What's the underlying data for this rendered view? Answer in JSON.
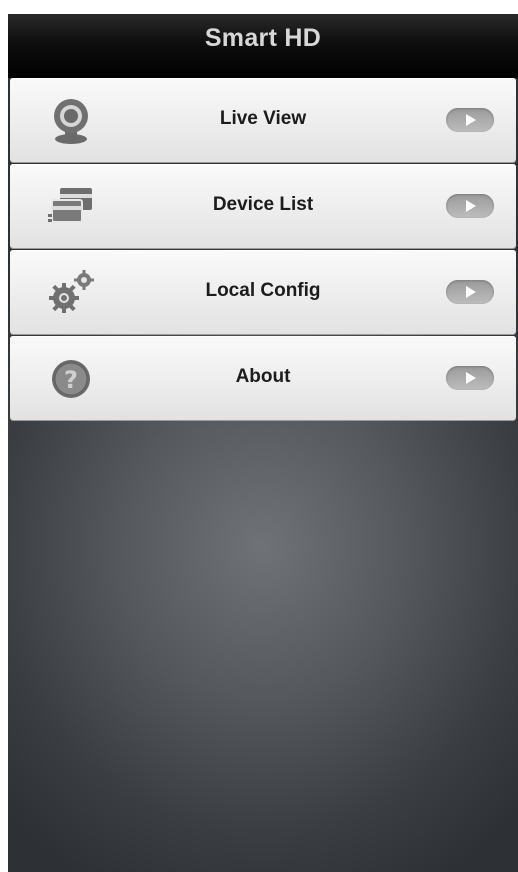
{
  "app": {
    "title": "Smart HD"
  },
  "menu": {
    "items": [
      {
        "label": "Live View",
        "icon": "webcam-icon"
      },
      {
        "label": "Device List",
        "icon": "device-list-icon"
      },
      {
        "label": "Local Config",
        "icon": "gears-icon"
      },
      {
        "label": "About",
        "icon": "help-icon"
      }
    ]
  },
  "colors": {
    "titlebar": "#000000",
    "title_text": "#d7d7d7",
    "item_background": "#ededed",
    "icon": "#6e6e6e",
    "arrow_button": "#b0b0b0"
  }
}
